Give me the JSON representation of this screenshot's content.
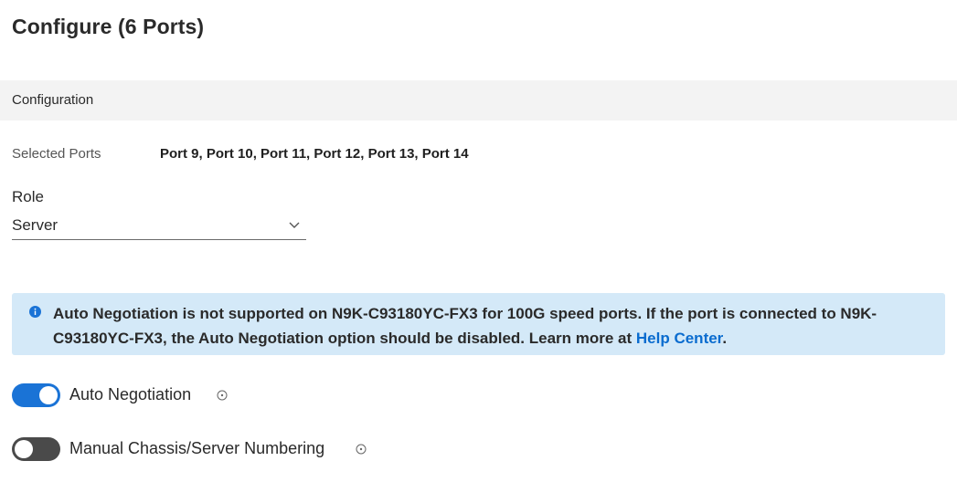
{
  "page": {
    "title": "Configure (6 Ports)"
  },
  "section": {
    "label": "Configuration"
  },
  "selected_ports": {
    "label": "Selected Ports",
    "value": "Port 9, Port 10, Port 11, Port 12, Port 13, Port 14"
  },
  "role": {
    "label": "Role",
    "value": "Server",
    "icon": "chevron-down-icon"
  },
  "banner": {
    "icon": "info-icon",
    "text": "Auto Negotiation is not supported on N9K-C93180YC-FX3 for 100G speed ports. If the port is connected to N9K-C93180YC-FX3, the Auto Negotiation option should be disabled. Learn more at ",
    "link_text": "Help Center",
    "suffix": ".",
    "background_color": "#d4e9f8",
    "link_color": "#0a6ccf"
  },
  "toggles": [
    {
      "label": "Auto Negotiation",
      "state": "on",
      "color": "#1a73d6",
      "info_icon": "info-circle-icon"
    },
    {
      "label": "Manual Chassis/Server Numbering",
      "state": "off",
      "color": "#4a4a4a",
      "info_icon": "info-circle-icon"
    }
  ]
}
